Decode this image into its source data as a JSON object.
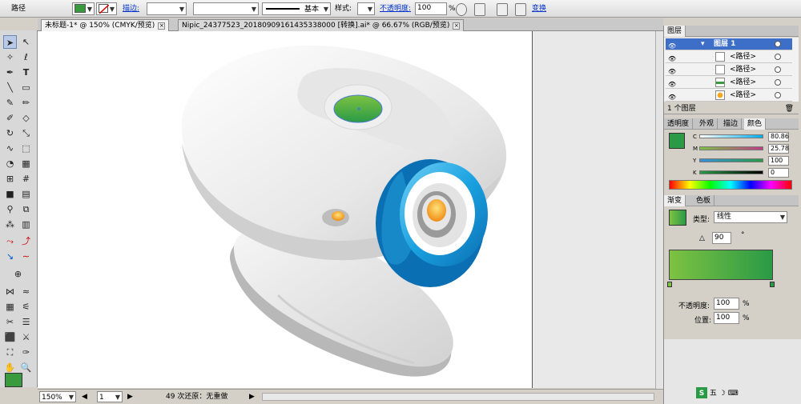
{
  "control_bar": {
    "object_type": "路径",
    "fill_color": "#3a9a3e",
    "stroke_label": "描边:",
    "stroke_style": "基本",
    "style_label": "样式:",
    "opacity_label": "不透明度:",
    "opacity_value": "100",
    "opacity_unit": "%",
    "transform_label": "变换"
  },
  "tabs": [
    {
      "label": "未标题-1* @ 150% (CMYK/预览)",
      "active": true
    },
    {
      "label": "Nipic_24377523_20180909161435338000  [转换].ai* @ 66.67% (RGB/预览)",
      "active": false
    }
  ],
  "status": {
    "zoom": "150%",
    "artboard": "1",
    "undo_info": "49 次还原：无重做"
  },
  "layers_panel": {
    "title": "图层",
    "layer_name": "图层 1",
    "paths": [
      "<路径>",
      "<路径>",
      "<路径>",
      "<路径>"
    ],
    "footer": "1 个图层"
  },
  "color_panel": {
    "tabs": [
      "透明度",
      "外观",
      "描边",
      "颜色"
    ],
    "active_tab": "颜色",
    "channels": [
      {
        "label": "C",
        "value": "80.86"
      },
      {
        "label": "M",
        "value": "25.78"
      },
      {
        "label": "Y",
        "value": "100"
      },
      {
        "label": "K",
        "value": "0"
      }
    ],
    "swatch": "#2a9a46"
  },
  "gradient_panel": {
    "tabs": [
      "渐变",
      "色板"
    ],
    "type_label": "类型:",
    "type_value": "线性",
    "angle": "90",
    "angle_unit": "°",
    "opacity_label": "不透明度:",
    "opacity_value": "100",
    "position_label": "位置:",
    "position_value": "100",
    "percent": "%",
    "start_color": "#7dc242",
    "end_color": "#2a9a46"
  },
  "taskbar": {
    "ime_label": "五"
  }
}
